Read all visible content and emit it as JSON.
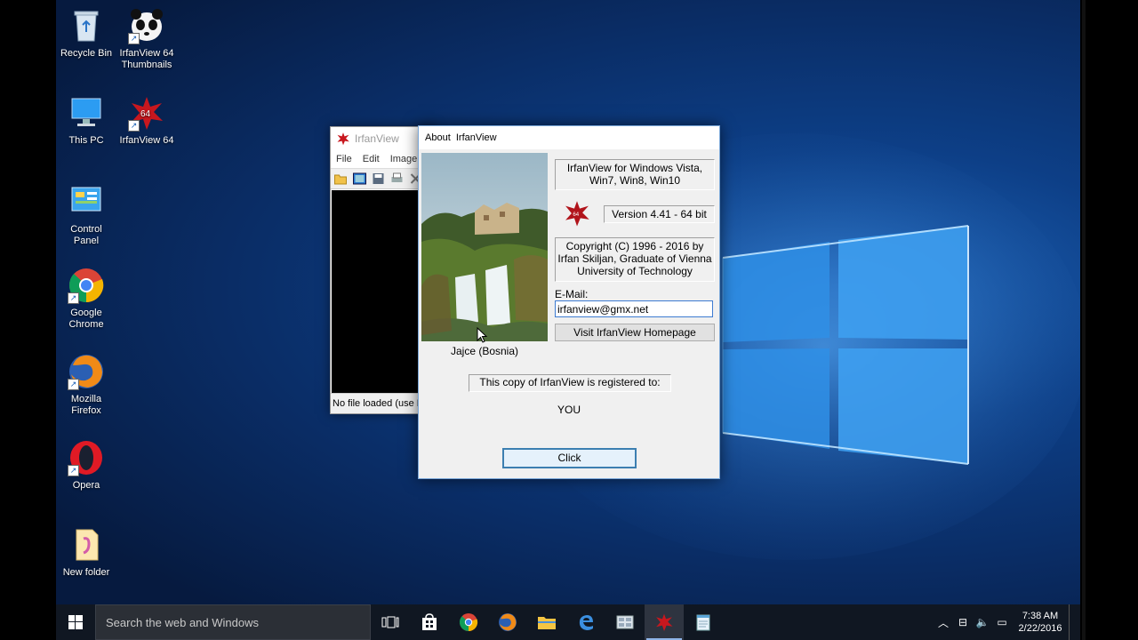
{
  "desktop": {
    "icons": [
      {
        "label_line1": "Recycle Bin",
        "label_line2": "",
        "icon": "recycle-bin-icon"
      },
      {
        "label_line1": "IrfanView 64",
        "label_line2": "Thumbnails",
        "icon": "irfanview-thumbnails-icon"
      },
      {
        "label_line1": "This PC",
        "label_line2": "",
        "icon": "this-pc-icon"
      },
      {
        "label_line1": "IrfanView 64",
        "label_line2": "",
        "icon": "irfanview-icon"
      },
      {
        "label_line1": "Control",
        "label_line2": "Panel",
        "icon": "control-panel-icon"
      },
      {
        "label_line1": "Google",
        "label_line2": "Chrome",
        "icon": "chrome-icon"
      },
      {
        "label_line1": "Mozilla",
        "label_line2": "Firefox",
        "icon": "firefox-icon"
      },
      {
        "label_line1": "Opera",
        "label_line2": "",
        "icon": "opera-icon"
      },
      {
        "label_line1": "New folder",
        "label_line2": "",
        "icon": "folder-icon"
      }
    ],
    "irfan_logo_text": "64"
  },
  "irfanview_window": {
    "title": "IrfanView",
    "menu": [
      "File",
      "Edit",
      "Image"
    ],
    "status": "No file loaded (use F"
  },
  "about_dialog": {
    "title": "About  IrfanView",
    "product": "IrfanView for Windows Vista, Win7, Win8, Win10",
    "version": "Version 4.41 - 64 bit",
    "copyright": "Copyright (C) 1996 - 2016 by Irfan Skiljan, Graduate of Vienna University of Technology",
    "email_label": "E-Mail:",
    "email_value": "irfanview@gmx.net",
    "homepage_button": "Visit IrfanView Homepage",
    "photo_caption": "Jajce (Bosnia)",
    "registered_label": "This copy of IrfanView is registered to:",
    "registered_to": "YOU",
    "click_button": "Click"
  },
  "taskbar": {
    "search_placeholder": "Search the web and Windows",
    "apps": [
      "task-view-icon",
      "store-icon",
      "chrome-icon",
      "firefox-icon",
      "file-explorer-icon",
      "edge-icon",
      "irfanview-thumbnails-icon",
      "irfanview-icon",
      "notepad-icon"
    ],
    "time": "7:38 AM",
    "date": "2/22/2016"
  },
  "colors": {
    "accent": "#3c7fb1",
    "wallpaper": "#0a2d66",
    "taskbar": "#101722"
  }
}
